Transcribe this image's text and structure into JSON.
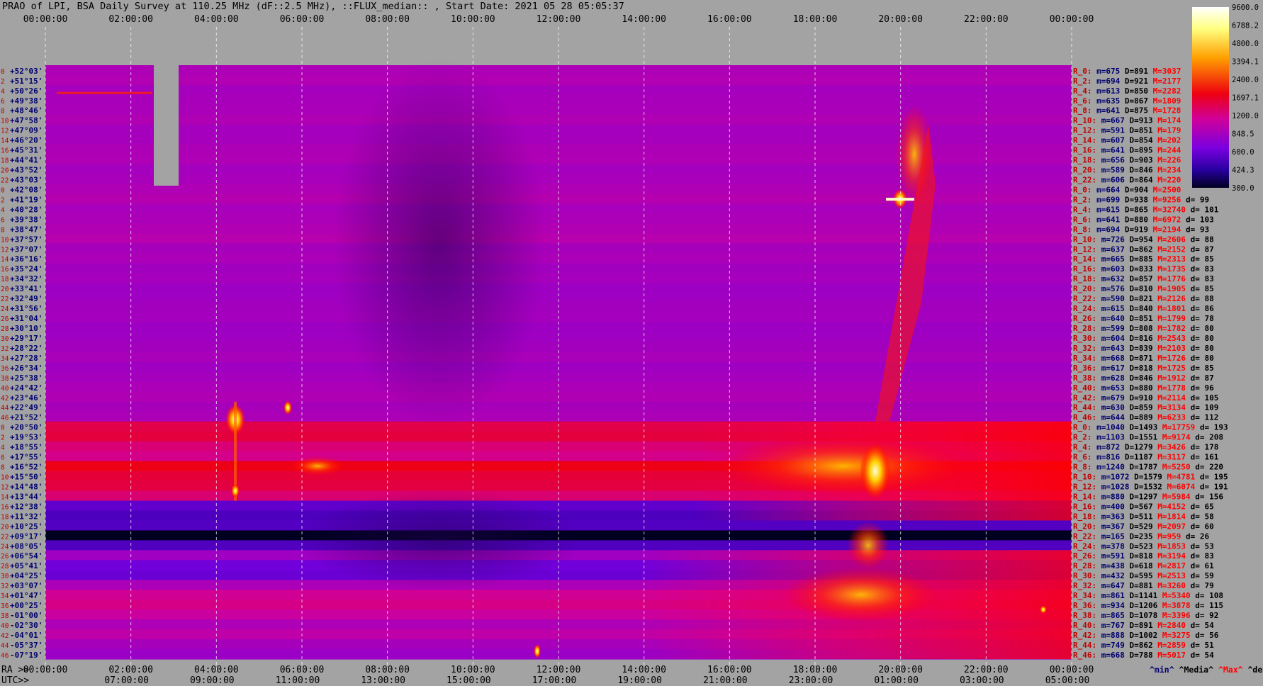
{
  "title": "PRAO of LPI, BSA Daily Survey at 110.25 MHz (dF::2.5 MHz), ::FLUX_median:: , Start Date: 2021 05 28 05:05:37",
  "chart_data": {
    "type": "heatmap",
    "title": "PRAO of LPI, BSA Daily Survey at 110.25 MHz (dF::2.5 MHz), ::FLUX_median:: , Start Date: 2021 05 28 05:05:37",
    "top_time_ticks": [
      "00:00:00",
      "02:00:00",
      "04:00:00",
      "06:00:00",
      "08:00:00",
      "10:00:00",
      "12:00:00",
      "14:00:00",
      "16:00:00",
      "18:00:00",
      "20:00:00",
      "22:00:00",
      "00:00:00"
    ],
    "bottom_ra_prefix": "RA >>",
    "bottom_ra_ticks": [
      "00:00:00",
      "02:00:00",
      "04:00:00",
      "06:00:00",
      "08:00:00",
      "10:00:00",
      "12:00:00",
      "14:00:00",
      "16:00:00",
      "18:00:00",
      "20:00:00",
      "22:00:00",
      "00:00:00"
    ],
    "bottom_utc_prefix": "UTC>>",
    "bottom_utc_ticks": [
      "07:00:00",
      "09:00:00",
      "11:00:00",
      "13:00:00",
      "15:00:00",
      "17:00:00",
      "19:00:00",
      "21:00:00",
      "23:00:00",
      "01:00:00",
      "03:00:00",
      "05:00:00"
    ],
    "colorbar_ticks": [
      "9600.0",
      "6788.2",
      "4800.0",
      "3394.1",
      "2400.0",
      "1697.1",
      "1200.0",
      "848.5",
      "600.0",
      "424.3",
      "300.0"
    ],
    "dec_labels": [
      "+52°03'",
      "+51°15'",
      "+50°26'",
      "+49°38'",
      "+48°46'",
      "+47°58'",
      "+47°09'",
      "+46°20'",
      "+45°31'",
      "+44°41'",
      "+43°52'",
      "+43°03'",
      "+42°08'",
      "+41°19'",
      "+40°28'",
      "+39°38'",
      "+38°47'",
      "+37°57'",
      "+37°07'",
      "+36°16'",
      "+35°24'",
      "+34°32'",
      "+33°41'",
      "+32°49'",
      "+31°56'",
      "+31°04'",
      "+30°10'",
      "+29°17'",
      "+28°22'",
      "+27°28'",
      "+26°34'",
      "+25°38'",
      "+24°42'",
      "+23°46'",
      "+22°49'",
      "+21°52'",
      "+20°50'",
      "+19°53'",
      "+18°55'",
      "+17°55'",
      "+16°52'",
      "+15°50'",
      "+14°48'",
      "+13°44'",
      "+12°38'",
      "+11°32'",
      "+10°25'",
      "+09°17'",
      "+08°05'",
      "+06°54'",
      "+05°41'",
      "+04°25'",
      "+03°07'",
      "+01°47'",
      "+00°25'",
      "-01°00'",
      "-02°30'",
      "-04°01'",
      "-05°37'",
      "-07°19'"
    ],
    "row_numbers": [
      "0",
      "2",
      "4",
      "6",
      "8",
      "10",
      "12",
      "14",
      "16",
      "18",
      "20",
      "22",
      "0",
      "2",
      "4",
      "6",
      "8",
      "10",
      "12",
      "14",
      "16",
      "18",
      "20",
      "22",
      "24",
      "26",
      "28",
      "30",
      "32",
      "34",
      "36",
      "38",
      "40",
      "42",
      "44",
      "46",
      "0",
      "2",
      "4",
      "6",
      "8",
      "10",
      "12",
      "14",
      "16",
      "18",
      "20",
      "22",
      "24",
      "26",
      "28",
      "30",
      "32",
      "34",
      "36",
      "38",
      "40",
      "42",
      "44",
      "46"
    ],
    "stats": [
      {
        "r": "R_0:",
        "m": "675",
        "D": "891",
        "M": "3037",
        "d": ""
      },
      {
        "r": "R_2:",
        "m": "694",
        "D": "921",
        "M": "2177",
        "d": ""
      },
      {
        "r": "R_4:",
        "m": "613",
        "D": "850",
        "M": "2282",
        "d": ""
      },
      {
        "r": "R_6:",
        "m": "635",
        "D": "867",
        "M": "1809",
        "d": ""
      },
      {
        "r": "R_8:",
        "m": "641",
        "D": "875",
        "M": "1728",
        "d": ""
      },
      {
        "r": "R_10:",
        "m": "667",
        "D": "913",
        "M": "174",
        "d": ""
      },
      {
        "r": "R_12:",
        "m": "591",
        "D": "851",
        "M": "179",
        "d": ""
      },
      {
        "r": "R_14:",
        "m": "607",
        "D": "854",
        "M": "202",
        "d": ""
      },
      {
        "r": "R_16:",
        "m": "641",
        "D": "895",
        "M": "244",
        "d": ""
      },
      {
        "r": "R_18:",
        "m": "656",
        "D": "903",
        "M": "226",
        "d": ""
      },
      {
        "r": "R_20:",
        "m": "589",
        "D": "846",
        "M": "234",
        "d": ""
      },
      {
        "r": "R_22:",
        "m": "606",
        "D": "864",
        "M": "220",
        "d": ""
      },
      {
        "r": "R_0:",
        "m": "664",
        "D": "904",
        "M": "2500",
        "d": ""
      },
      {
        "r": "R_2:",
        "m": "699",
        "D": "938",
        "M": "9256",
        "d": "99"
      },
      {
        "r": "R_4:",
        "m": "615",
        "D": "865",
        "M": "32740",
        "d": "101"
      },
      {
        "r": "R_6:",
        "m": "641",
        "D": "880",
        "M": "6972",
        "d": "103"
      },
      {
        "r": "R_8:",
        "m": "694",
        "D": "919",
        "M": "2194",
        "d": "93"
      },
      {
        "r": "R_10:",
        "m": "726",
        "D": "954",
        "M": "2606",
        "d": "88"
      },
      {
        "r": "R_12:",
        "m": "637",
        "D": "862",
        "M": "2152",
        "d": "87"
      },
      {
        "r": "R_14:",
        "m": "665",
        "D": "885",
        "M": "2313",
        "d": "85"
      },
      {
        "r": "R_16:",
        "m": "603",
        "D": "833",
        "M": "1735",
        "d": "83"
      },
      {
        "r": "R_18:",
        "m": "632",
        "D": "857",
        "M": "1776",
        "d": "83"
      },
      {
        "r": "R_20:",
        "m": "576",
        "D": "810",
        "M": "1905",
        "d": "85"
      },
      {
        "r": "R_22:",
        "m": "590",
        "D": "821",
        "M": "2126",
        "d": "88"
      },
      {
        "r": "R_24:",
        "m": "615",
        "D": "840",
        "M": "1801",
        "d": "86"
      },
      {
        "r": "R_26:",
        "m": "640",
        "D": "851",
        "M": "1799",
        "d": "78"
      },
      {
        "r": "R_28:",
        "m": "599",
        "D": "808",
        "M": "1782",
        "d": "80"
      },
      {
        "r": "R_30:",
        "m": "604",
        "D": "816",
        "M": "2543",
        "d": "80"
      },
      {
        "r": "R_32:",
        "m": "643",
        "D": "839",
        "M": "2103",
        "d": "80"
      },
      {
        "r": "R_34:",
        "m": "668",
        "D": "871",
        "M": "1726",
        "d": "80"
      },
      {
        "r": "R_36:",
        "m": "617",
        "D": "818",
        "M": "1725",
        "d": "85"
      },
      {
        "r": "R_38:",
        "m": "628",
        "D": "846",
        "M": "1912",
        "d": "87"
      },
      {
        "r": "R_40:",
        "m": "653",
        "D": "880",
        "M": "1778",
        "d": "96"
      },
      {
        "r": "R_42:",
        "m": "679",
        "D": "910",
        "M": "2114",
        "d": "105"
      },
      {
        "r": "R_44:",
        "m": "630",
        "D": "859",
        "M": "3134",
        "d": "109"
      },
      {
        "r": "R_46:",
        "m": "644",
        "D": "889",
        "M": "6233",
        "d": "112"
      },
      {
        "r": "R_0:",
        "m": "1040",
        "D": "1493",
        "M": "17759",
        "d": "193"
      },
      {
        "r": "R_2:",
        "m": "1103",
        "D": "1551",
        "M": "9174",
        "d": "208"
      },
      {
        "r": "R_4:",
        "m": "872",
        "D": "1279",
        "M": "3426",
        "d": "178"
      },
      {
        "r": "R_6:",
        "m": "816",
        "D": "1187",
        "M": "3117",
        "d": "161"
      },
      {
        "r": "R_8:",
        "m": "1240",
        "D": "1787",
        "M": "5250",
        "d": "220"
      },
      {
        "r": "R_10:",
        "m": "1072",
        "D": "1579",
        "M": "4781",
        "d": "195"
      },
      {
        "r": "R_12:",
        "m": "1028",
        "D": "1532",
        "M": "6074",
        "d": "191"
      },
      {
        "r": "R_14:",
        "m": "880",
        "D": "1297",
        "M": "5984",
        "d": "156"
      },
      {
        "r": "R_16:",
        "m": "400",
        "D": "567",
        "M": "4152",
        "d": "65"
      },
      {
        "r": "R_18:",
        "m": "363",
        "D": "511",
        "M": "1814",
        "d": "58"
      },
      {
        "r": "R_20:",
        "m": "367",
        "D": "529",
        "M": "2097",
        "d": "60"
      },
      {
        "r": "R_22:",
        "m": "165",
        "D": "235",
        "M": "959",
        "d": "26"
      },
      {
        "r": "R_24:",
        "m": "378",
        "D": "523",
        "M": "1853",
        "d": "53"
      },
      {
        "r": "R_26:",
        "m": "591",
        "D": "818",
        "M": "3194",
        "d": "83"
      },
      {
        "r": "R_28:",
        "m": "438",
        "D": "618",
        "M": "2817",
        "d": "61"
      },
      {
        "r": "R_30:",
        "m": "432",
        "D": "595",
        "M": "2513",
        "d": "59"
      },
      {
        "r": "R_32:",
        "m": "647",
        "D": "881",
        "M": "3260",
        "d": "79"
      },
      {
        "r": "R_34:",
        "m": "861",
        "D": "1141",
        "M": "5340",
        "d": "108"
      },
      {
        "r": "R_36:",
        "m": "934",
        "D": "1206",
        "M": "3878",
        "d": "115"
      },
      {
        "r": "R_38:",
        "m": "865",
        "D": "1078",
        "M": "3396",
        "d": "92"
      },
      {
        "r": "R_40:",
        "m": "767",
        "D": "891",
        "M": "2840",
        "d": "54"
      },
      {
        "r": "R_42:",
        "m": "888",
        "D": "1002",
        "M": "3275",
        "d": "56"
      },
      {
        "r": "R_44:",
        "m": "749",
        "D": "862",
        "M": "2859",
        "d": "51"
      },
      {
        "r": "R_46:",
        "m": "668",
        "D": "788",
        "M": "5017",
        "d": "54"
      }
    ],
    "stats_legend": {
      "min": "^min^",
      "median": "^Media^",
      "max": "^Max^",
      "devia": "^devia^"
    }
  },
  "colors": {
    "background": "#a3a3a3",
    "row_label": "#c00000",
    "dec_label": "#00006e",
    "max_label": "#ff0000"
  }
}
